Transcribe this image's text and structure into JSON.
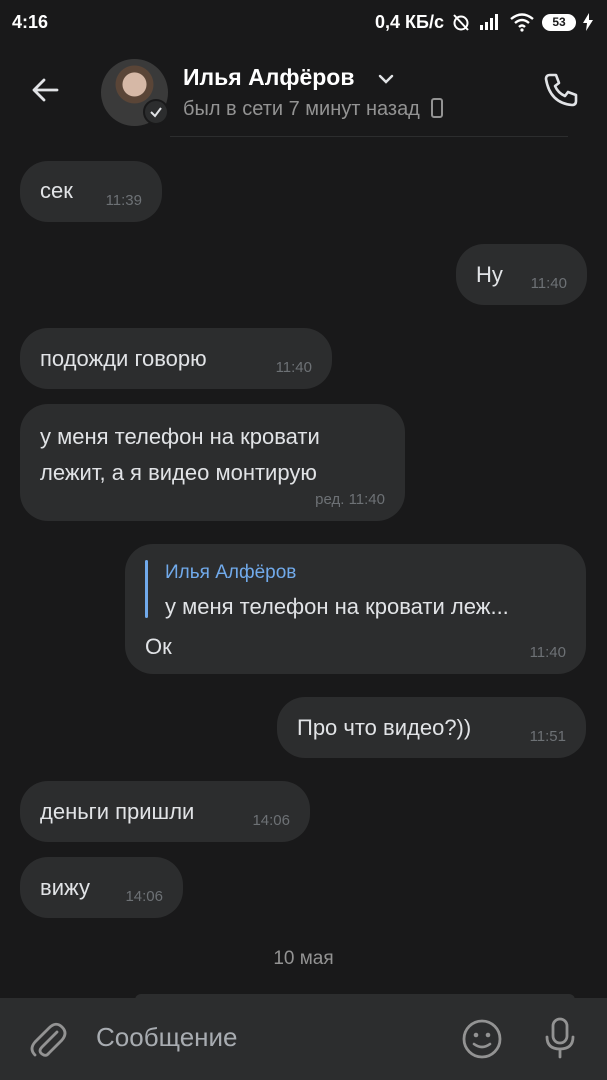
{
  "status_bar": {
    "time": "4:16",
    "net_speed": "0,4 КБ/с",
    "battery": "53"
  },
  "header": {
    "contact_name": "Илья Алфёров",
    "status": "был в сети 7 минут назад"
  },
  "messages": [
    {
      "side": "in",
      "text": "сек",
      "time": "11:39"
    },
    {
      "side": "out",
      "text": "Ну",
      "time": "11:40"
    },
    {
      "side": "in",
      "text": "подожди говорю",
      "time": "11:40"
    },
    {
      "side": "in",
      "text_line1": "у меня телефон на кровати",
      "text_line2": "лежит, а я видео монтирую",
      "time": "ред. 11:40"
    },
    {
      "side": "out",
      "reply_author": "Илья Алфёров",
      "reply_text": "у меня телефон на кровати леж...",
      "text": "Ок",
      "time": "11:40"
    },
    {
      "side": "out",
      "text": "Про что видео?))",
      "time": "11:51"
    },
    {
      "side": "in",
      "text": "деньги пришли",
      "time": "14:06"
    },
    {
      "side": "in",
      "text": "вижу",
      "time": "14:06"
    }
  ],
  "date_separator": "10 мая",
  "composer": {
    "placeholder": "Сообщение"
  },
  "colors": {
    "background": "#19191a",
    "bubble": "#2c2d2e",
    "accent": "#71aaeb",
    "meta_text": "#6d7175"
  },
  "icons": [
    "back-arrow-icon",
    "verified-check-icon",
    "chevron-down-icon",
    "phone-icon",
    "phone-device-icon",
    "attach-icon",
    "emoji-icon",
    "mic-icon"
  ]
}
